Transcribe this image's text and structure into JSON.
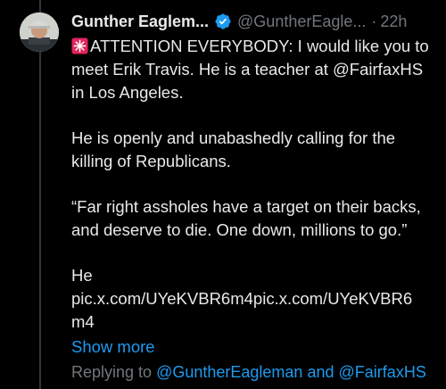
{
  "author": {
    "name": "Gunther Eaglem...",
    "handle": "@GuntherEagle...",
    "separator": "·",
    "time": "22h"
  },
  "tweet": {
    "p1": "ATTENTION EVERYBODY: I would like you to meet Erik Travis. He is a teacher at @FairfaxHS in Los Angeles.",
    "p2": "He is openly and unabashedly calling for the killing of Republicans.",
    "p3": "“Far right assholes have a target on their backs, and deserve to die. One down, millions to go.”",
    "p4a": "He",
    "p4b": "pic.x.com/UYeKVBR6m4pic.x.com/UYeKVBR6",
    "p4c": "m4",
    "show_more": "Show more"
  },
  "replying": {
    "prefix": "Replying to",
    "user1": "@GuntherEagleman",
    "and": "and",
    "user2": "@FairfaxHS"
  },
  "icons": {
    "verified": "verified-badge-icon",
    "siren": "siren-emoji-icon"
  },
  "colors": {
    "background": "#000000",
    "text": "#e7e9ea",
    "muted": "#71767b",
    "link": "#1d9bf0"
  }
}
